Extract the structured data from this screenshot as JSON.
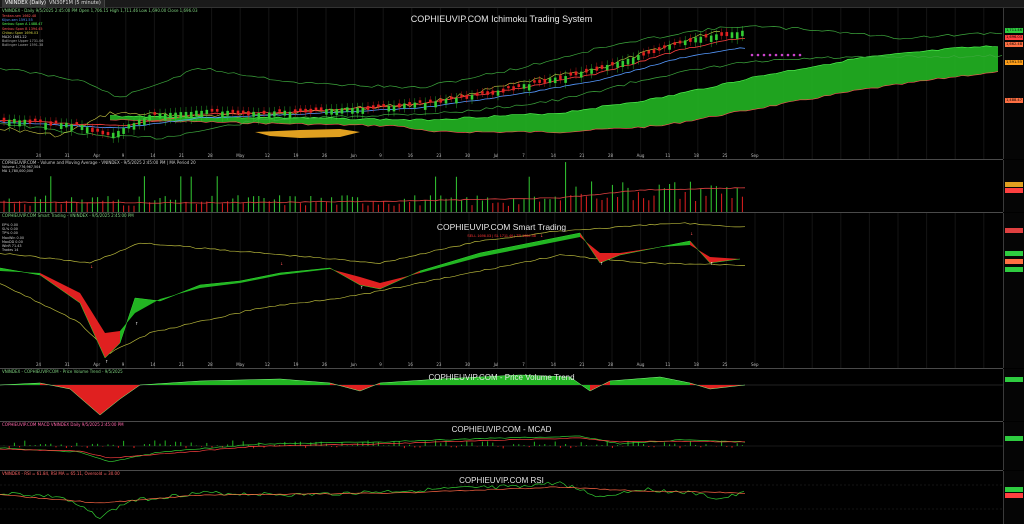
{
  "tabs": [
    {
      "label": "VNINDEX (Daily)"
    },
    {
      "label": "VN30F1M (5 minute)"
    }
  ],
  "panes": {
    "ichimoku": {
      "title": "COPHIEUVIP.COM Ichimoku Trading System",
      "header": "VNINDEX - Daily 9/5/2025 2:45:00 PM  Open 1,706.15  High 1,711.46  Low 1,690.00  Close 1,696.03",
      "legend": [
        {
          "text": "Tenkan-sen 1662.48",
          "color": "#ff5555"
        },
        {
          "text": "Kijun-sen 1591.55",
          "color": "#5599ff"
        },
        {
          "text": "Senkou Span A 1488.47",
          "color": "#55ff55"
        },
        {
          "text": "Senkou Span B 1394.45",
          "color": "#ff5555"
        },
        {
          "text": "Chikou Span 1696.03",
          "color": "#cccc44"
        },
        {
          "text": "MA20 1661.22",
          "color": "#dddddd"
        },
        {
          "text": "Bollinger Upper 1731.06",
          "color": "#aaaaaa"
        },
        {
          "text": "Bollinger Lower 1591.38",
          "color": "#aaaaaa"
        }
      ],
      "price_labels": [
        {
          "text": "1,711.46",
          "color": "#2ecc40"
        },
        {
          "text": "1,696.03",
          "color": "#ff4040"
        },
        {
          "text": "1,662.48",
          "color": "#ff7043"
        },
        {
          "text": "1,591.55",
          "color": "#ff9f1a"
        },
        {
          "text": "1,488.47",
          "color": "#ff7043"
        }
      ]
    },
    "volume": {
      "header": "COPHIEUVIP.COM - Volume and Moving Average - VNINDEX - 9/5/2025 2:45:00 PM | MA Period 20",
      "legend": [
        {
          "text": "Volume 1,776,967,504",
          "color": "#dddddd"
        },
        {
          "text": "MA 1,780,000,000",
          "color": "#dddddd"
        }
      ]
    },
    "smart": {
      "title": "COPHIEUVIP.COM Smart Trading",
      "header": "COPHIEUVIP.COM Smart Trading - VNINDEX - 9/5/2025 2:45:00 PM",
      "legend": [
        {
          "text": "EP%  0.00",
          "color": "#cccccc"
        },
        {
          "text": "SL%  0.00",
          "color": "#cccccc"
        },
        {
          "text": "TP%  0.00",
          "color": "#cccccc"
        },
        {
          "text": "MaxWin  0.00",
          "color": "#cccccc"
        },
        {
          "text": "MaxDD  0.00",
          "color": "#cccccc"
        },
        {
          "text": "WinR  71.43",
          "color": "#cccccc"
        },
        {
          "text": "Trades  14",
          "color": "#cccccc"
        }
      ],
      "signal_text": "SELL 1696.03 | SL 1711.46 | TP 1662.48"
    },
    "pvt": {
      "title": "COPHIEUVIP.COM - Price Volume Trend",
      "header": "VNINDEX - COPHIEUVIP.COM - Price Volume Trend - 9/5/2025"
    },
    "macd": {
      "title": "COPHIEUVIP.COM - MCAD",
      "header": "COPHIEUVIP.COM MACD  VNINDEX  Daily  9/5/2025 2:45:00 PM"
    },
    "rsi": {
      "title": "COPHIEUVIP.COM RSI",
      "header": "VNINDEX - RSI = 61.84, RSI MA = 65.11, Oversold = 30.00"
    }
  },
  "dates": [
    "24",
    "31",
    "Apr",
    "9",
    "14",
    "21",
    "28",
    "May",
    "12",
    "19",
    "26",
    "Jun",
    "9",
    "16",
    "23",
    "30",
    "Jul",
    "7",
    "14",
    "21",
    "28",
    "Aug",
    "11",
    "18",
    "25",
    "Sep"
  ],
  "colors": {
    "bull": "#33cc33",
    "bear": "#e02020",
    "cloud_up": "#22b522",
    "cloud_down": "#e0a020",
    "background": "#000000"
  }
}
